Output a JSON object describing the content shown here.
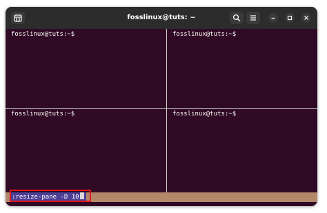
{
  "window": {
    "title": "fosslinux@tuts: ~"
  },
  "titlebar": {
    "new_tab_icon": "new-tab-icon",
    "search_icon": "search-icon",
    "menu_icon": "hamburger-menu-icon",
    "minimize_icon": "minimize-icon",
    "maximize_icon": "maximize-icon",
    "close_icon": "close-icon"
  },
  "panes": [
    {
      "prompt": "fosslinux@tuts:~$"
    },
    {
      "prompt": "fosslinux@tuts:~$"
    },
    {
      "prompt": "fosslinux@tuts:~$"
    },
    {
      "prompt": "fosslinux@tuts:~$"
    }
  ],
  "statusbar": {
    "command": ":resize-pane -D 10"
  },
  "colors": {
    "terminal_bg": "#300a24",
    "titlebar_bg": "#2c2c2c",
    "statusbar_bg": "#b3886a",
    "command_highlight": "#4d3e96",
    "annotation": "#e3141c"
  }
}
